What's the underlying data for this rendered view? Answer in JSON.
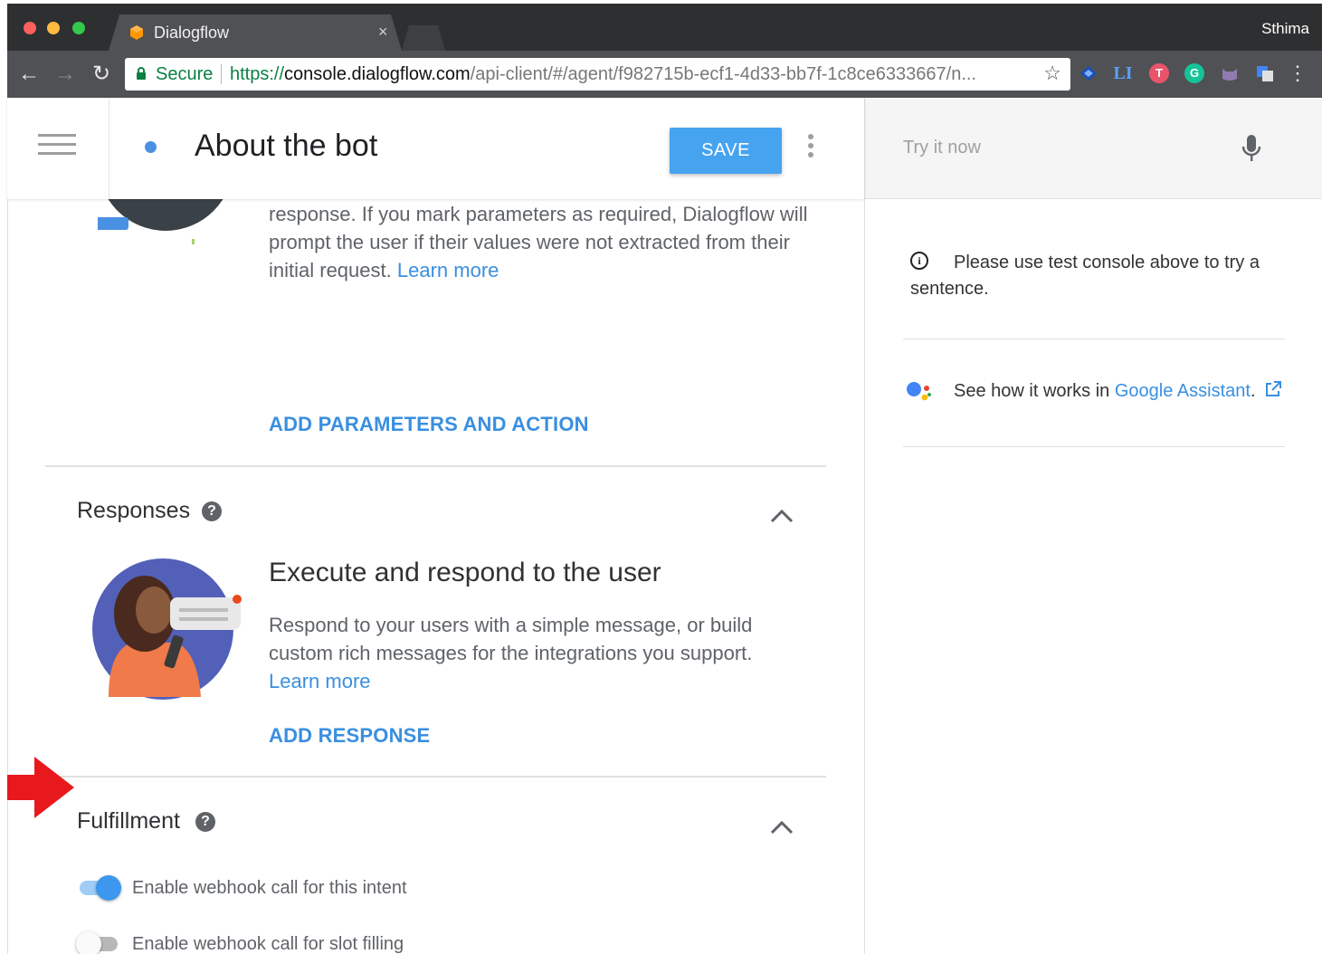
{
  "browser": {
    "tab_title": "Dialogflow",
    "tab_close": "×",
    "profile_name": "Sthima",
    "secure_label": "Secure",
    "url_scheme": "https://",
    "url_host": "console.dialogflow.com",
    "url_path": "/api-client/#/agent/f982715b-ecf1-4d33-bb7f-1c8ce6333667/n...",
    "extensions": [
      "LI",
      "T",
      "G"
    ]
  },
  "header": {
    "title": "About the bot",
    "save_label": "SAVE"
  },
  "actions_section": {
    "text": "response. If you mark parameters as required, Dialogflow will prompt the user if their values were not extracted from their initial request.",
    "learn_more": "Learn more",
    "add_label": "ADD PARAMETERS AND ACTION"
  },
  "responses_section": {
    "title": "Responses",
    "heading": "Execute and respond to the user",
    "text": "Respond to your users with a simple message, or build custom rich messages for the integrations you support.",
    "learn_more": "Learn more",
    "add_label": "ADD RESPONSE"
  },
  "fulfillment_section": {
    "title": "Fulfillment",
    "webhook_intent_label": "Enable webhook call for this intent",
    "webhook_intent_on": true,
    "slot_filling_label": "Enable webhook call for slot filling",
    "slot_filling_on": false
  },
  "right_panel": {
    "try_placeholder": "Try it now",
    "info_text": "Please use test console above to try a sentence.",
    "assistant_prefix": "See how it works in ",
    "assistant_link": "Google Assistant",
    "assistant_suffix": "."
  },
  "colors": {
    "accent": "#3a8fe0",
    "save_button": "#46a3f0",
    "annotation_arrow": "#e8191c"
  }
}
